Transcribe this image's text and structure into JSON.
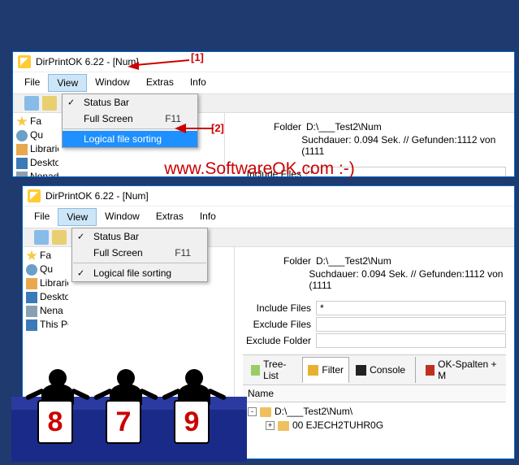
{
  "app": {
    "title": "DirPrintOK 6.22 - [Num]"
  },
  "menubar": [
    "File",
    "View",
    "Window",
    "Extras",
    "Info"
  ],
  "dropdown1": {
    "items": [
      {
        "label": "Status Bar",
        "checked": true,
        "shortcut": ""
      },
      {
        "label": "Full Screen",
        "checked": false,
        "shortcut": "F11"
      },
      {
        "label": "Logical file sorting",
        "checked": false,
        "shortcut": "",
        "highlight": true
      }
    ]
  },
  "dropdown2": {
    "items": [
      {
        "label": "Status Bar",
        "checked": true,
        "shortcut": ""
      },
      {
        "label": "Full Screen",
        "checked": false,
        "shortcut": "F11"
      },
      {
        "label": "Logical file sorting",
        "checked": true,
        "shortcut": ""
      }
    ]
  },
  "sidebar1": [
    "Fa",
    "Qu",
    "Libraries",
    "Desktop",
    "Nonad"
  ],
  "sidebar2": [
    "Fa",
    "Qu",
    "Libraries",
    "Desktop",
    "Nena",
    "This PC"
  ],
  "rightpane": {
    "folder_label": "Folder",
    "folder_value": "D:\\___Test2\\Num",
    "search_info": "Suchdauer: 0.094 Sek. //  Gefunden:1112 von (1111",
    "include_label": "Include Files",
    "include_value": "*",
    "exclude_files_label": "Exclude Files",
    "exclude_files_value": "",
    "exclude_folder_label": "Exclude Folder",
    "exclude_folder_value": ""
  },
  "tabs": {
    "tree": "Tree-List",
    "filter": "Filter",
    "console": "Console",
    "spalten": "OK-Spalten + M"
  },
  "list": {
    "header": "Name",
    "root": "D:\\___Test2\\Num\\",
    "child": "00 EJECH2TUHR0G"
  },
  "annotations": {
    "a1": "[1]",
    "a2": "[2]"
  },
  "watermark": "www.SoftwareOK.com :-)",
  "judges": {
    "scores": [
      "8",
      "7",
      "9"
    ]
  }
}
